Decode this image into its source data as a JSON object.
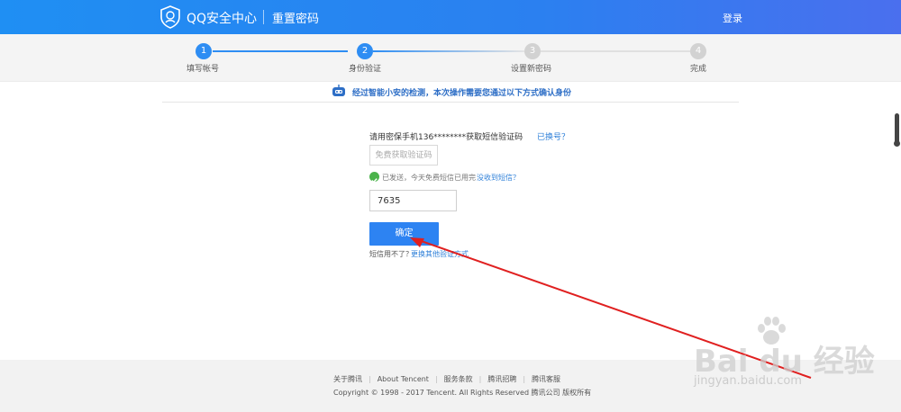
{
  "header": {
    "brand": "QQ安全中心",
    "subtitle": "重置密码",
    "login": "登录"
  },
  "steps": [
    {
      "number": "1",
      "label": "填写帐号",
      "state": "done"
    },
    {
      "number": "2",
      "label": "身份验证",
      "state": "active"
    },
    {
      "number": "3",
      "label": "设置新密码",
      "state": "pending"
    },
    {
      "number": "4",
      "label": "完成",
      "state": "pending"
    }
  ],
  "notice": {
    "text": "经过智能小安的检测，本次操作需要您通过以下方式确认身份"
  },
  "verify": {
    "prompt": "请用密保手机136********获取短信验证码",
    "change_link": "已换号？",
    "get_code_button": "免费获取验证码",
    "sent_status": "已发送，今天免费短信已用完",
    "not_received_link": "没收到短信？",
    "code_value": "7635",
    "confirm_button": "确定",
    "alt_prefix": "短信用不了？",
    "alt_link": "更换其他验证方式"
  },
  "footer": {
    "links": [
      "关于腾讯",
      "About Tencent",
      "服务条款",
      "腾讯招聘",
      "腾讯客服"
    ],
    "copyright": "Copyright © 1998 - 2017 Tencent. All Rights Reserved 腾讯公司 版权所有"
  },
  "watermark": {
    "main": "Bai du 经验",
    "sub": "jingyan.baidu.com"
  },
  "colors": {
    "accent": "#2e8df3",
    "header_start": "#1f8ff3",
    "success": "#4bb34b",
    "annotation_arrow": "#e02020"
  }
}
